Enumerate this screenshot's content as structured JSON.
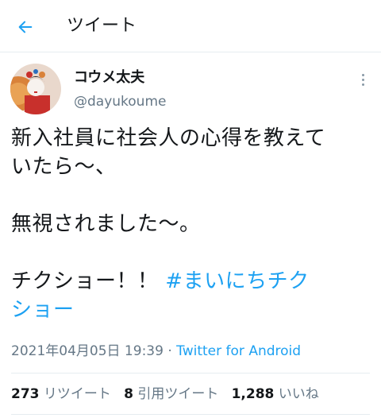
{
  "header": {
    "title": "ツイート",
    "back_icon": "arrow-left-icon"
  },
  "tweet": {
    "display_name": "コウメ太夫",
    "handle": "@dayukoume",
    "text_line1": "新入社員に社会人の心得を教えて",
    "text_line2": "いたら～、",
    "text_line3": "無視されました～。",
    "text_line4": "チクショー！！",
    "hashtag_part1": "#まいにちチク",
    "hashtag_part2": "ショー",
    "timestamp": "2021年04月05日 19:39",
    "separator": "·",
    "source": "Twitter for Android"
  },
  "stats": {
    "retweets_count": "273",
    "retweets_label": "リツイート",
    "quotes_count": "8",
    "quotes_label": "引用ツイート",
    "likes_count": "1,288",
    "likes_label": "いいね"
  },
  "colors": {
    "accent": "#1da1f2",
    "text": "#14171a",
    "secondary": "#657786",
    "divider": "#e6ecf0"
  }
}
